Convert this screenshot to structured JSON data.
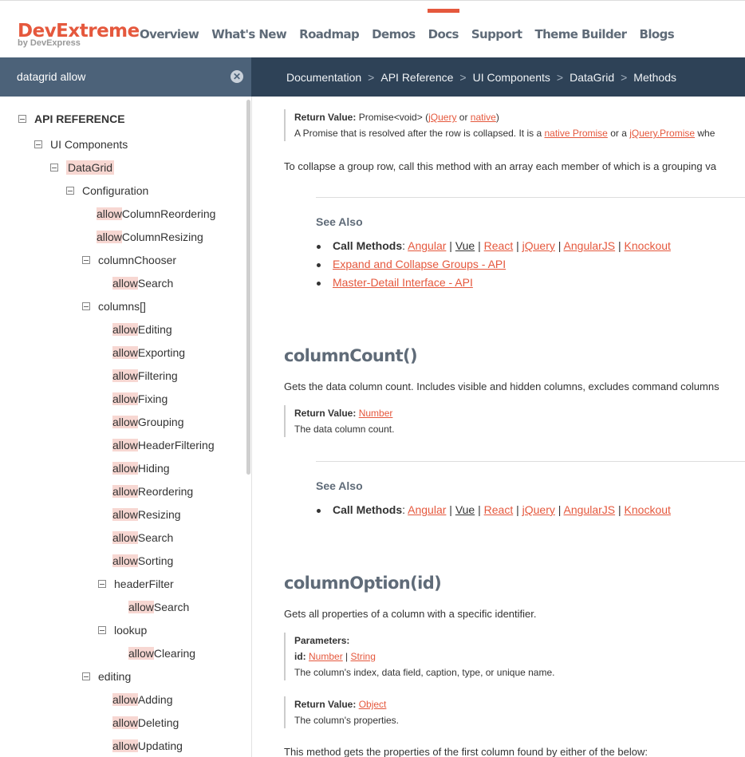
{
  "header": {
    "logo_name": "DevExtreme",
    "logo_sub": "by DevExpress",
    "nav": [
      "Overview",
      "What's New",
      "Roadmap",
      "Demos",
      "Docs",
      "Support",
      "Theme Builder",
      "Blogs"
    ],
    "active_nav": "Docs",
    "accent_color": "#e5583d"
  },
  "search": {
    "value": "datagrid allow",
    "clear_icon": "close-circle-icon"
  },
  "breadcrumb": [
    "Documentation",
    "API Reference",
    "UI Components",
    "DataGrid",
    "Methods"
  ],
  "sidebar": {
    "root": "API REFERENCE",
    "l1": "UI Components",
    "l2": "DataGrid",
    "l3": "Configuration",
    "hl": "allow",
    "items": [
      {
        "rest": "ColumnReordering"
      },
      {
        "rest": "ColumnResizing"
      }
    ],
    "columnChooser": "columnChooser",
    "cc_items": [
      {
        "rest": "Search"
      }
    ],
    "columns": "columns[]",
    "col_items": [
      {
        "rest": "Editing"
      },
      {
        "rest": "Exporting"
      },
      {
        "rest": "Filtering"
      },
      {
        "rest": "Fixing"
      },
      {
        "rest": "Grouping"
      },
      {
        "rest": "HeaderFiltering"
      },
      {
        "rest": "Hiding"
      },
      {
        "rest": "Reordering"
      },
      {
        "rest": "Resizing"
      },
      {
        "rest": "Search"
      },
      {
        "rest": "Sorting"
      }
    ],
    "headerFilter": "headerFilter",
    "hf_items": [
      {
        "rest": "Search"
      }
    ],
    "lookup": "lookup",
    "lk_items": [
      {
        "rest": "Clearing"
      }
    ],
    "editing": "editing",
    "ed_items": [
      {
        "rest": "Adding"
      },
      {
        "rest": "Deleting"
      },
      {
        "rest": "Updating"
      }
    ]
  },
  "main": {
    "rv1": {
      "label": "Return Value:",
      "type": "Promise<void>",
      "open": "(",
      "link1": "jQuery",
      "or": "or",
      "link2": "native",
      "close": ")",
      "desc_pre": "A Promise that is resolved after the row is collapsed. It is a",
      "desc_link1": "native Promise",
      "desc_mid": "or a",
      "desc_link2": "jQuery.Promise",
      "desc_post": "whe"
    },
    "collapse_para": "To collapse a group row, call this method with an array each member of which is a grouping va",
    "see_also_1": {
      "title": "See Also",
      "call_label": "Call Methods",
      "call_links": [
        "Angular",
        "Vue",
        "React",
        "jQuery",
        "AngularJS",
        "Knockout"
      ],
      "links": [
        "Expand and Collapse Groups - API",
        "Master-Detail Interface - API"
      ]
    },
    "columnCount": {
      "title": "columnCount()",
      "desc": "Gets the data column count. Includes visible and hidden columns, excludes command columns",
      "rv_label": "Return Value:",
      "rv_type": "Number",
      "rv_desc": "The data column count."
    },
    "see_also_2": {
      "title": "See Also",
      "call_label": "Call Methods",
      "call_links": [
        "Angular",
        "Vue",
        "React",
        "jQuery",
        "AngularJS",
        "Knockout"
      ]
    },
    "columnOption": {
      "title": "columnOption(id)",
      "desc": "Gets all properties of a column with a specific identifier.",
      "params_label": "Parameters:",
      "param_name": "id:",
      "param_type1": "Number",
      "param_sep": "|",
      "param_type2": "String",
      "param_desc": "The column's index, data field, caption, type, or unique name.",
      "rv_label": "Return Value:",
      "rv_type": "Object",
      "rv_desc": "The column's properties."
    },
    "bottom_para": "This method gets the properties of the first column found by either of the below:"
  }
}
